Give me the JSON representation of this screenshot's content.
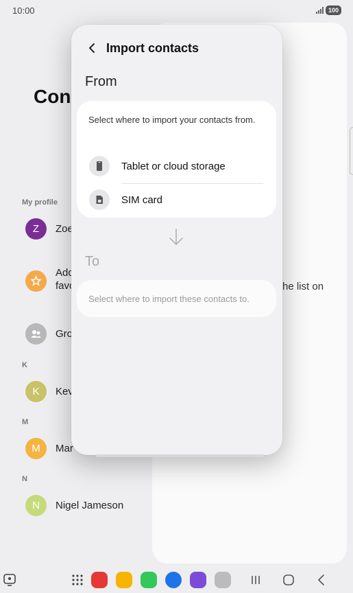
{
  "status_bar": {
    "time": "10:00",
    "battery": "100"
  },
  "background": {
    "title": "Con",
    "my_profile_label": "My profile",
    "right_hint": "he list on",
    "contacts": [
      {
        "initial": "Z",
        "name": "Zoe",
        "color": "#7b2d96"
      },
      {
        "initial": "",
        "name": "Add favo",
        "color": "#f5a94a"
      },
      {
        "initial": "",
        "name": "Gro",
        "color": "#b8b8b8"
      },
      {
        "initial": "K",
        "name": "Kev",
        "color": "#c9c268"
      },
      {
        "initial": "M",
        "name": "Mar",
        "color": "#f5b342"
      },
      {
        "initial": "N",
        "name": "Nigel Jameson",
        "color": "#c5db7a"
      }
    ],
    "section_headers": [
      "K",
      "M",
      "N"
    ]
  },
  "dialog": {
    "title": "Import contacts",
    "from_label": "From",
    "from_description": "Select where to import your contacts from.",
    "options": [
      {
        "label": "Tablet or cloud storage",
        "icon": "tablet-icon"
      },
      {
        "label": "SIM card",
        "icon": "sim-card-icon"
      }
    ],
    "to_label": "To",
    "to_description": "Select where to import these contacts to."
  },
  "taskbar": {
    "apps": [
      {
        "name": "app-drawer-icon",
        "color": "#444444"
      },
      {
        "name": "notes-app-icon",
        "color": "#e53935"
      },
      {
        "name": "files-app-icon",
        "color": "#f4b400"
      },
      {
        "name": "phone-app-icon",
        "color": "#34c759"
      },
      {
        "name": "messages-app-icon",
        "color": "#1e73e8"
      },
      {
        "name": "internet-app-icon",
        "color": "#7b4dd6"
      },
      {
        "name": "camera-app-icon",
        "color": "#bbbbbb"
      }
    ]
  },
  "colors": {
    "accent": "#7b2d96",
    "dialog_bg": "#f1f1f3",
    "card_bg": "#ffffff"
  }
}
